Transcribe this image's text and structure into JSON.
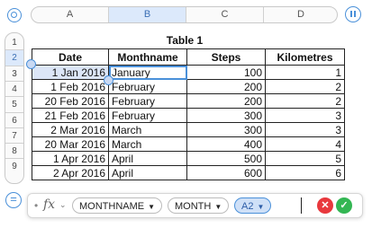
{
  "columns": [
    "A",
    "B",
    "C",
    "D"
  ],
  "selected_column": "B",
  "rows": [
    "1",
    "2",
    "3",
    "4",
    "5",
    "6",
    "7",
    "8",
    "9"
  ],
  "selected_row": "2",
  "table": {
    "title": "Table 1",
    "headers": [
      "Date",
      "Monthname",
      "Steps",
      "Kilometres"
    ],
    "data": [
      [
        "1 Jan 2016",
        "January",
        "100",
        "1"
      ],
      [
        "1 Feb 2016",
        "February",
        "200",
        "2"
      ],
      [
        "20 Feb 2016",
        "February",
        "200",
        "2"
      ],
      [
        "21 Feb 2016",
        "February",
        "300",
        "3"
      ],
      [
        "2 Mar 2016",
        "March",
        "300",
        "3"
      ],
      [
        "20 Mar 2016",
        "March",
        "400",
        "4"
      ],
      [
        "1 Apr 2016",
        "April",
        "500",
        "5"
      ],
      [
        "2 Apr 2016",
        "April",
        "600",
        "6"
      ]
    ]
  },
  "formula_bar": {
    "fx_label": "fx",
    "tokens": [
      {
        "label": "MONTHNAME",
        "type": "function"
      },
      {
        "label": "MONTH",
        "type": "function"
      },
      {
        "label": "A2",
        "type": "reference"
      }
    ],
    "cancel_symbol": "✕",
    "confirm_symbol": "✓"
  },
  "colors": {
    "accent": "#4a90d9",
    "selection": "#dce6f7",
    "cancel": "#e8383d",
    "confirm": "#33b653"
  }
}
